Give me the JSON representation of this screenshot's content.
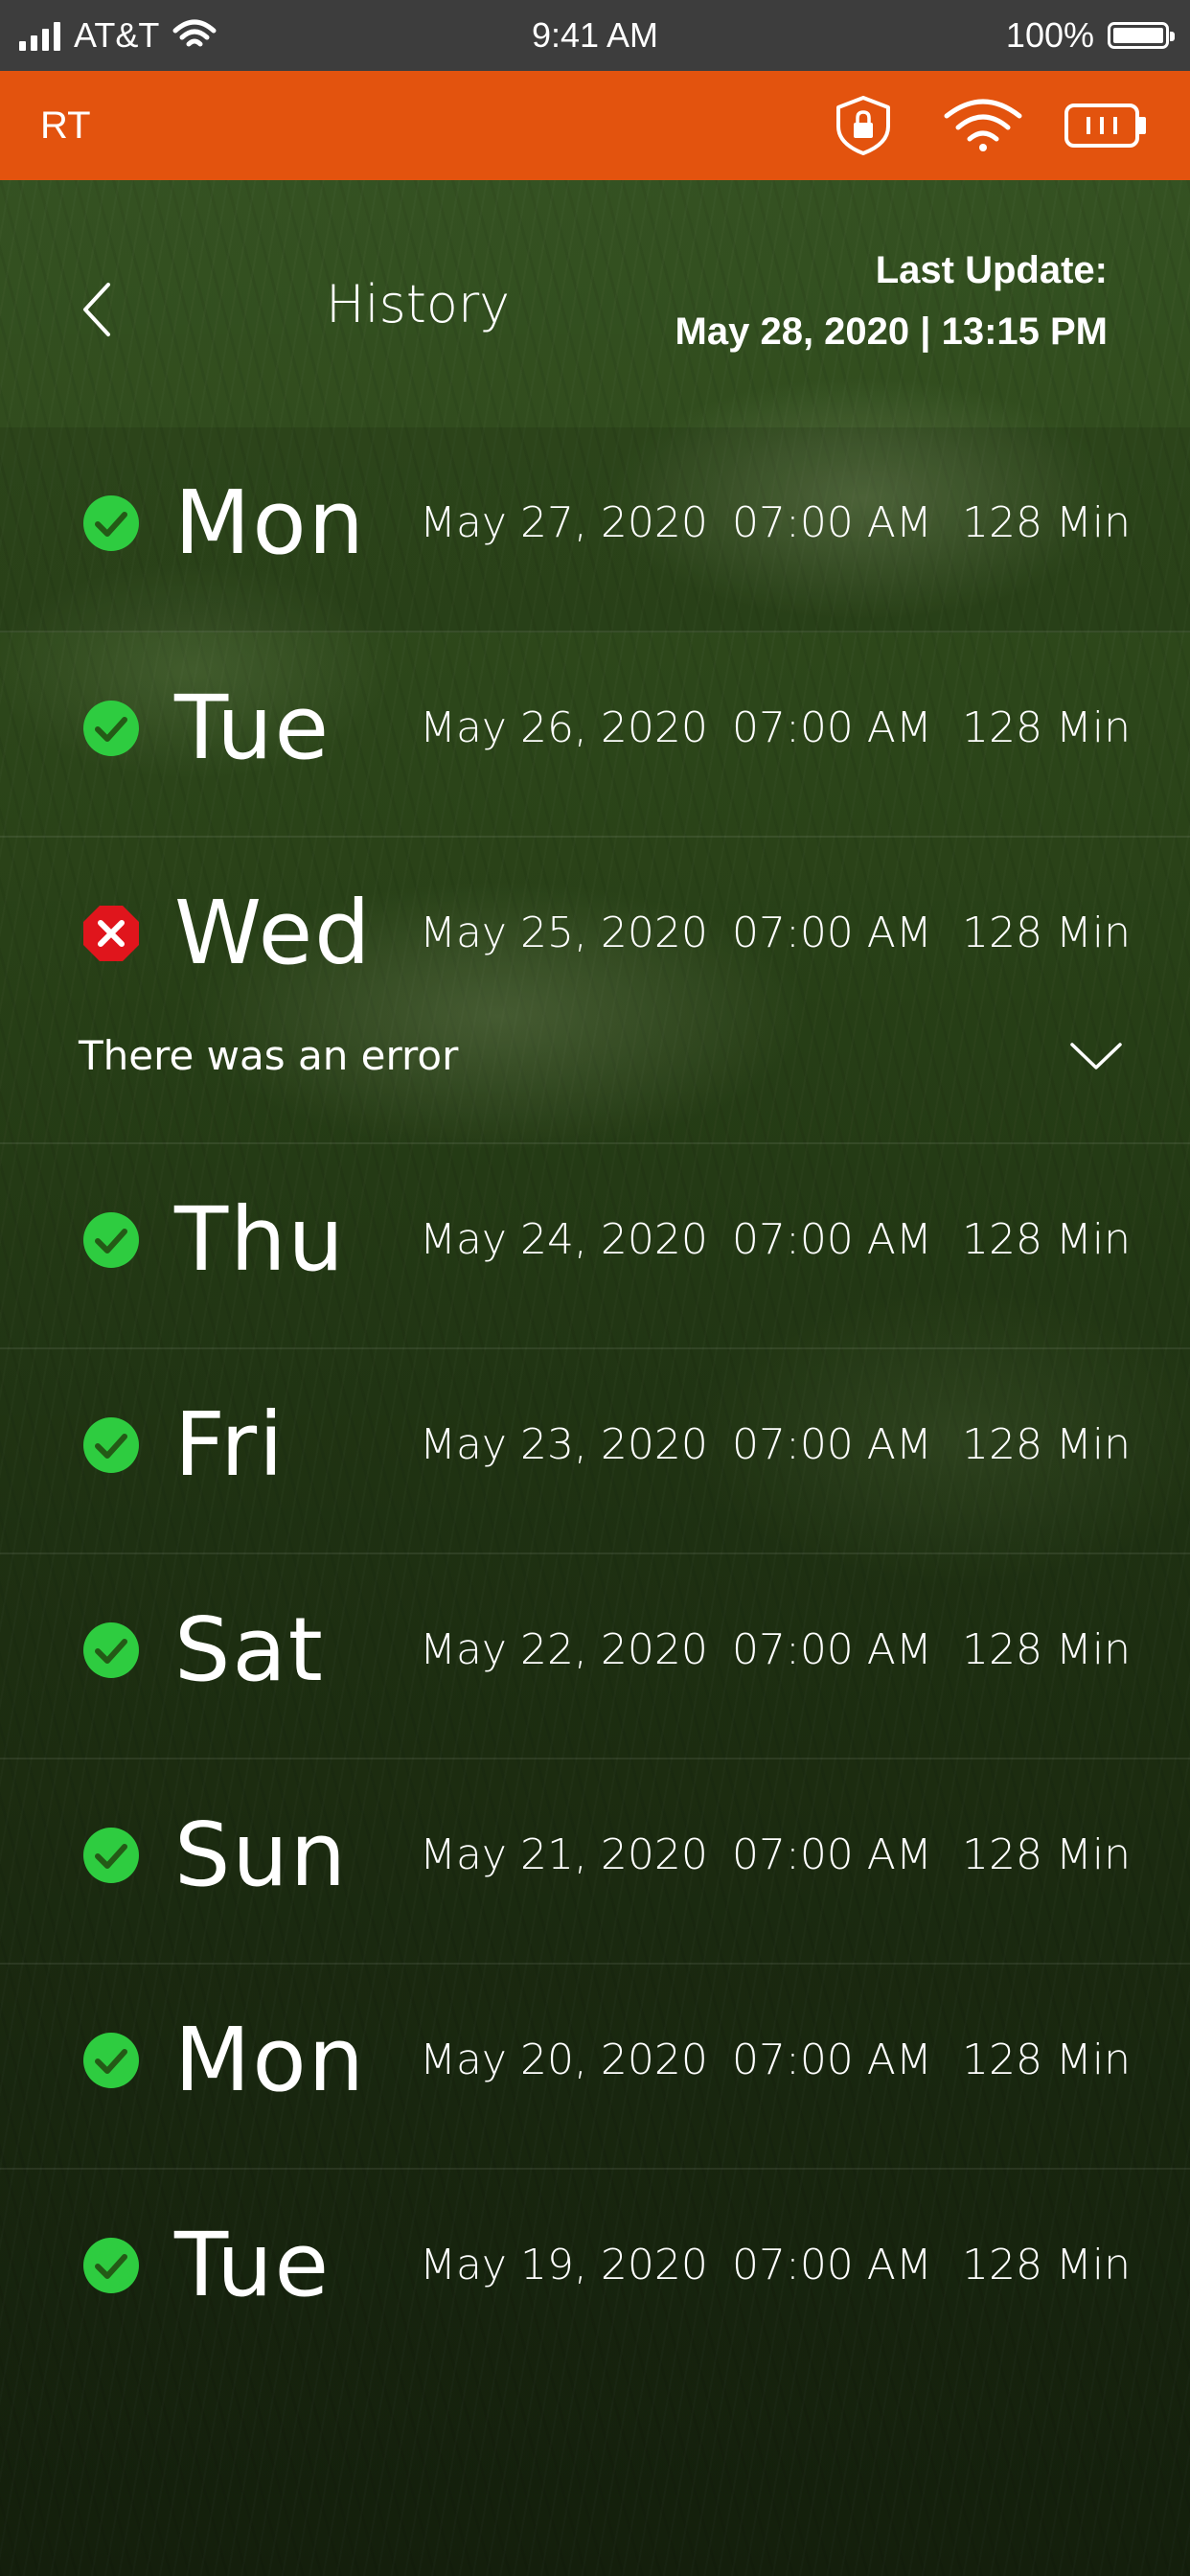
{
  "status_bar": {
    "carrier": "AT&T",
    "time": "9:41 AM",
    "battery": "100%",
    "battery_level": 1.0
  },
  "app_bar": {
    "title": "RT",
    "icons": [
      "shield-lock-icon",
      "wifi-icon",
      "battery-icon"
    ],
    "accent_color": "#e3530e"
  },
  "header": {
    "title": "History",
    "last_update_label": "Last Update:",
    "last_update_value": "May 28, 2020 | 13:15 PM"
  },
  "colors": {
    "success": "#2ecc40",
    "error": "#e0151c"
  },
  "history": [
    {
      "status": "success",
      "day": "Mon",
      "date": "May 27, 2020",
      "time": "07:00 AM",
      "duration": "128 Min"
    },
    {
      "status": "success",
      "day": "Tue",
      "date": "May 26, 2020",
      "time": "07:00 AM",
      "duration": "128 Min"
    },
    {
      "status": "error",
      "day": "Wed",
      "date": "May 25, 2020",
      "time": "07:00 AM",
      "duration": "128 Min",
      "error_message": "There was an error"
    },
    {
      "status": "success",
      "day": "Thu",
      "date": "May 24, 2020",
      "time": "07:00 AM",
      "duration": "128 Min"
    },
    {
      "status": "success",
      "day": "Fri",
      "date": "May 23, 2020",
      "time": "07:00 AM",
      "duration": "128 Min"
    },
    {
      "status": "success",
      "day": "Sat",
      "date": "May 22, 2020",
      "time": "07:00 AM",
      "duration": "128 Min"
    },
    {
      "status": "success",
      "day": "Sun",
      "date": "May 21, 2020",
      "time": "07:00 AM",
      "duration": "128 Min"
    },
    {
      "status": "success",
      "day": "Mon",
      "date": "May 20, 2020",
      "time": "07:00 AM",
      "duration": "128 Min"
    },
    {
      "status": "success",
      "day": "Tue",
      "date": "May 19, 2020",
      "time": "07:00 AM",
      "duration": "128 Min"
    }
  ]
}
